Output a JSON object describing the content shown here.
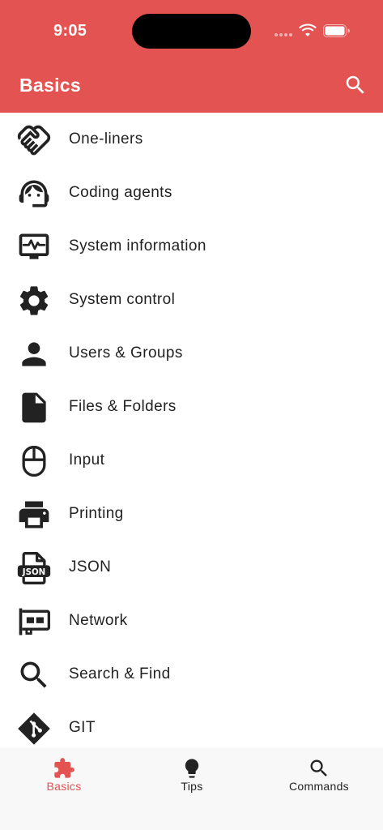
{
  "theme": {
    "primary": "#e35352",
    "text": "#222222",
    "nav_active": "#e35352",
    "nav_inactive": "#222222",
    "nav_bg": "#f8f8f8"
  },
  "status_bar": {
    "time": "9:05"
  },
  "app_bar": {
    "title": "Basics",
    "action_icon": "search-icon"
  },
  "items": [
    {
      "label": "One-liners",
      "icon": "handshake-icon"
    },
    {
      "label": "Coding agents",
      "icon": "support-agent-icon"
    },
    {
      "label": "System information",
      "icon": "monitor-heart-icon"
    },
    {
      "label": "System control",
      "icon": "gear-icon"
    },
    {
      "label": "Users & Groups",
      "icon": "person-icon"
    },
    {
      "label": "Files & Folders",
      "icon": "file-icon"
    },
    {
      "label": "Input",
      "icon": "mouse-icon"
    },
    {
      "label": "Printing",
      "icon": "printer-icon"
    },
    {
      "label": "JSON",
      "icon": "json-file-icon"
    },
    {
      "label": "Network",
      "icon": "network-card-icon"
    },
    {
      "label": "Search & Find",
      "icon": "search-icon"
    },
    {
      "label": "GIT",
      "icon": "git-icon"
    }
  ],
  "bottom_nav": {
    "items": [
      {
        "label": "Basics",
        "icon": "puzzle-icon",
        "active": true
      },
      {
        "label": "Tips",
        "icon": "lightbulb-icon",
        "active": false
      },
      {
        "label": "Commands",
        "icon": "search-icon",
        "active": false
      }
    ]
  }
}
